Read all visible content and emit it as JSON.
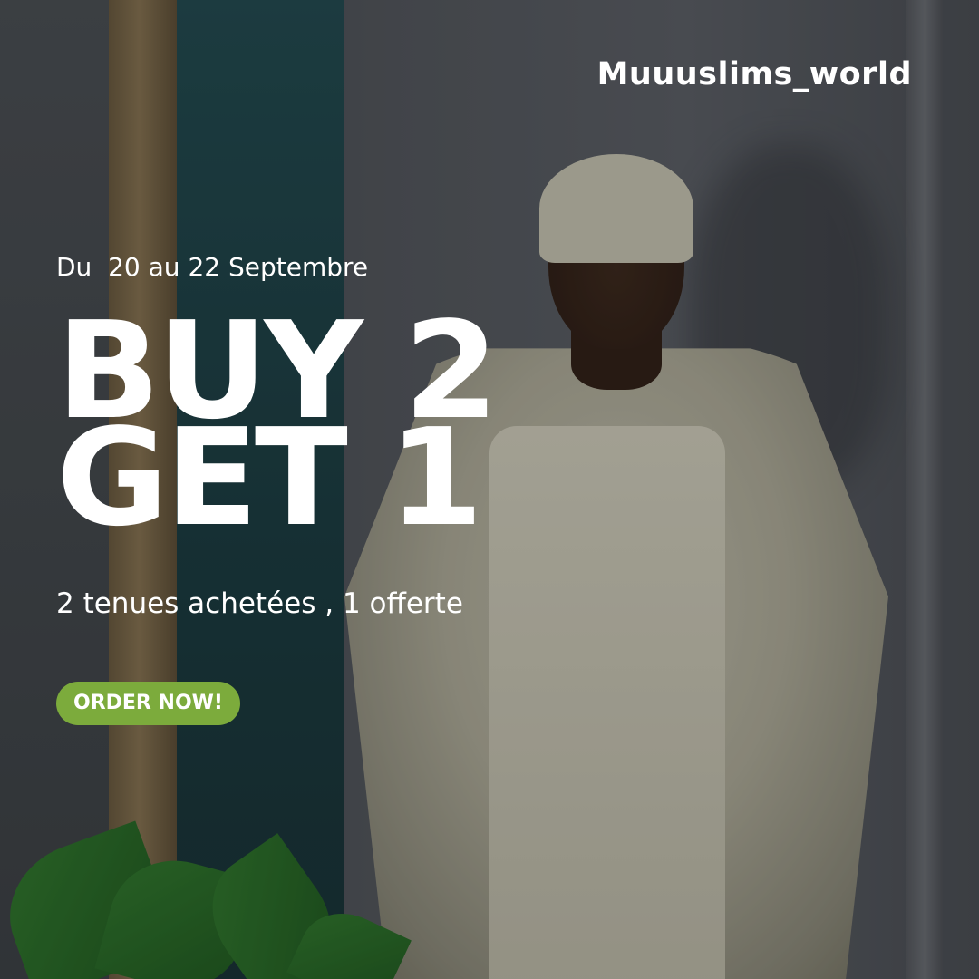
{
  "brand": {
    "handle": "Muuuslims_world"
  },
  "promo": {
    "dates": "Du  20 au 22 Septembre",
    "headline_line1": "BUY 2",
    "headline_line2": "GET 1",
    "subtitle": "2 tenues achetées , 1 offerte",
    "cta_label": "ORDER NOW!"
  },
  "colors": {
    "text": "#ffffff",
    "cta_background": "#7cab3c"
  }
}
